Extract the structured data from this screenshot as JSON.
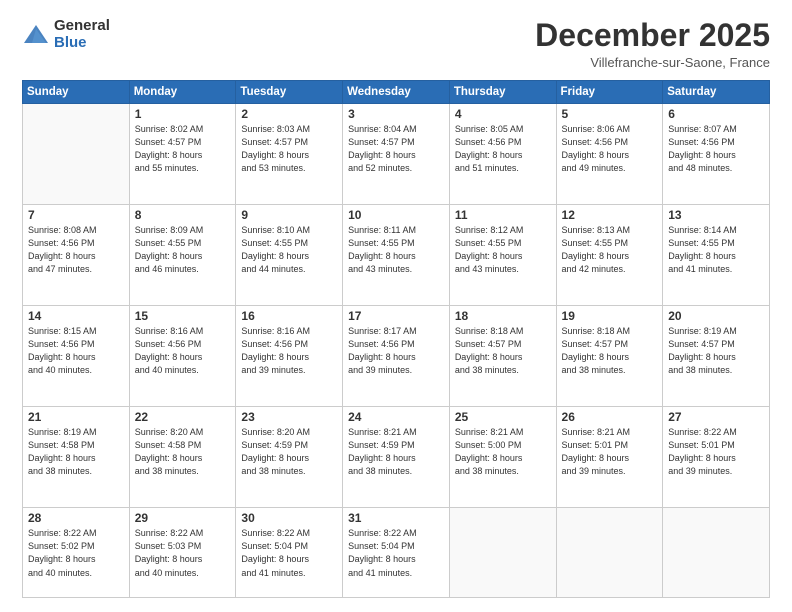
{
  "logo": {
    "general": "General",
    "blue": "Blue"
  },
  "header": {
    "month": "December 2025",
    "location": "Villefranche-sur-Saone, France"
  },
  "days_of_week": [
    "Sunday",
    "Monday",
    "Tuesday",
    "Wednesday",
    "Thursday",
    "Friday",
    "Saturday"
  ],
  "weeks": [
    [
      {
        "day": "",
        "info": ""
      },
      {
        "day": "1",
        "info": "Sunrise: 8:02 AM\nSunset: 4:57 PM\nDaylight: 8 hours\nand 55 minutes."
      },
      {
        "day": "2",
        "info": "Sunrise: 8:03 AM\nSunset: 4:57 PM\nDaylight: 8 hours\nand 53 minutes."
      },
      {
        "day": "3",
        "info": "Sunrise: 8:04 AM\nSunset: 4:57 PM\nDaylight: 8 hours\nand 52 minutes."
      },
      {
        "day": "4",
        "info": "Sunrise: 8:05 AM\nSunset: 4:56 PM\nDaylight: 8 hours\nand 51 minutes."
      },
      {
        "day": "5",
        "info": "Sunrise: 8:06 AM\nSunset: 4:56 PM\nDaylight: 8 hours\nand 49 minutes."
      },
      {
        "day": "6",
        "info": "Sunrise: 8:07 AM\nSunset: 4:56 PM\nDaylight: 8 hours\nand 48 minutes."
      }
    ],
    [
      {
        "day": "7",
        "info": "Sunrise: 8:08 AM\nSunset: 4:56 PM\nDaylight: 8 hours\nand 47 minutes."
      },
      {
        "day": "8",
        "info": "Sunrise: 8:09 AM\nSunset: 4:55 PM\nDaylight: 8 hours\nand 46 minutes."
      },
      {
        "day": "9",
        "info": "Sunrise: 8:10 AM\nSunset: 4:55 PM\nDaylight: 8 hours\nand 44 minutes."
      },
      {
        "day": "10",
        "info": "Sunrise: 8:11 AM\nSunset: 4:55 PM\nDaylight: 8 hours\nand 43 minutes."
      },
      {
        "day": "11",
        "info": "Sunrise: 8:12 AM\nSunset: 4:55 PM\nDaylight: 8 hours\nand 43 minutes."
      },
      {
        "day": "12",
        "info": "Sunrise: 8:13 AM\nSunset: 4:55 PM\nDaylight: 8 hours\nand 42 minutes."
      },
      {
        "day": "13",
        "info": "Sunrise: 8:14 AM\nSunset: 4:55 PM\nDaylight: 8 hours\nand 41 minutes."
      }
    ],
    [
      {
        "day": "14",
        "info": "Sunrise: 8:15 AM\nSunset: 4:56 PM\nDaylight: 8 hours\nand 40 minutes."
      },
      {
        "day": "15",
        "info": "Sunrise: 8:16 AM\nSunset: 4:56 PM\nDaylight: 8 hours\nand 40 minutes."
      },
      {
        "day": "16",
        "info": "Sunrise: 8:16 AM\nSunset: 4:56 PM\nDaylight: 8 hours\nand 39 minutes."
      },
      {
        "day": "17",
        "info": "Sunrise: 8:17 AM\nSunset: 4:56 PM\nDaylight: 8 hours\nand 39 minutes."
      },
      {
        "day": "18",
        "info": "Sunrise: 8:18 AM\nSunset: 4:57 PM\nDaylight: 8 hours\nand 38 minutes."
      },
      {
        "day": "19",
        "info": "Sunrise: 8:18 AM\nSunset: 4:57 PM\nDaylight: 8 hours\nand 38 minutes."
      },
      {
        "day": "20",
        "info": "Sunrise: 8:19 AM\nSunset: 4:57 PM\nDaylight: 8 hours\nand 38 minutes."
      }
    ],
    [
      {
        "day": "21",
        "info": "Sunrise: 8:19 AM\nSunset: 4:58 PM\nDaylight: 8 hours\nand 38 minutes."
      },
      {
        "day": "22",
        "info": "Sunrise: 8:20 AM\nSunset: 4:58 PM\nDaylight: 8 hours\nand 38 minutes."
      },
      {
        "day": "23",
        "info": "Sunrise: 8:20 AM\nSunset: 4:59 PM\nDaylight: 8 hours\nand 38 minutes."
      },
      {
        "day": "24",
        "info": "Sunrise: 8:21 AM\nSunset: 4:59 PM\nDaylight: 8 hours\nand 38 minutes."
      },
      {
        "day": "25",
        "info": "Sunrise: 8:21 AM\nSunset: 5:00 PM\nDaylight: 8 hours\nand 38 minutes."
      },
      {
        "day": "26",
        "info": "Sunrise: 8:21 AM\nSunset: 5:01 PM\nDaylight: 8 hours\nand 39 minutes."
      },
      {
        "day": "27",
        "info": "Sunrise: 8:22 AM\nSunset: 5:01 PM\nDaylight: 8 hours\nand 39 minutes."
      }
    ],
    [
      {
        "day": "28",
        "info": "Sunrise: 8:22 AM\nSunset: 5:02 PM\nDaylight: 8 hours\nand 40 minutes."
      },
      {
        "day": "29",
        "info": "Sunrise: 8:22 AM\nSunset: 5:03 PM\nDaylight: 8 hours\nand 40 minutes."
      },
      {
        "day": "30",
        "info": "Sunrise: 8:22 AM\nSunset: 5:04 PM\nDaylight: 8 hours\nand 41 minutes."
      },
      {
        "day": "31",
        "info": "Sunrise: 8:22 AM\nSunset: 5:04 PM\nDaylight: 8 hours\nand 41 minutes."
      },
      {
        "day": "",
        "info": ""
      },
      {
        "day": "",
        "info": ""
      },
      {
        "day": "",
        "info": ""
      }
    ]
  ]
}
